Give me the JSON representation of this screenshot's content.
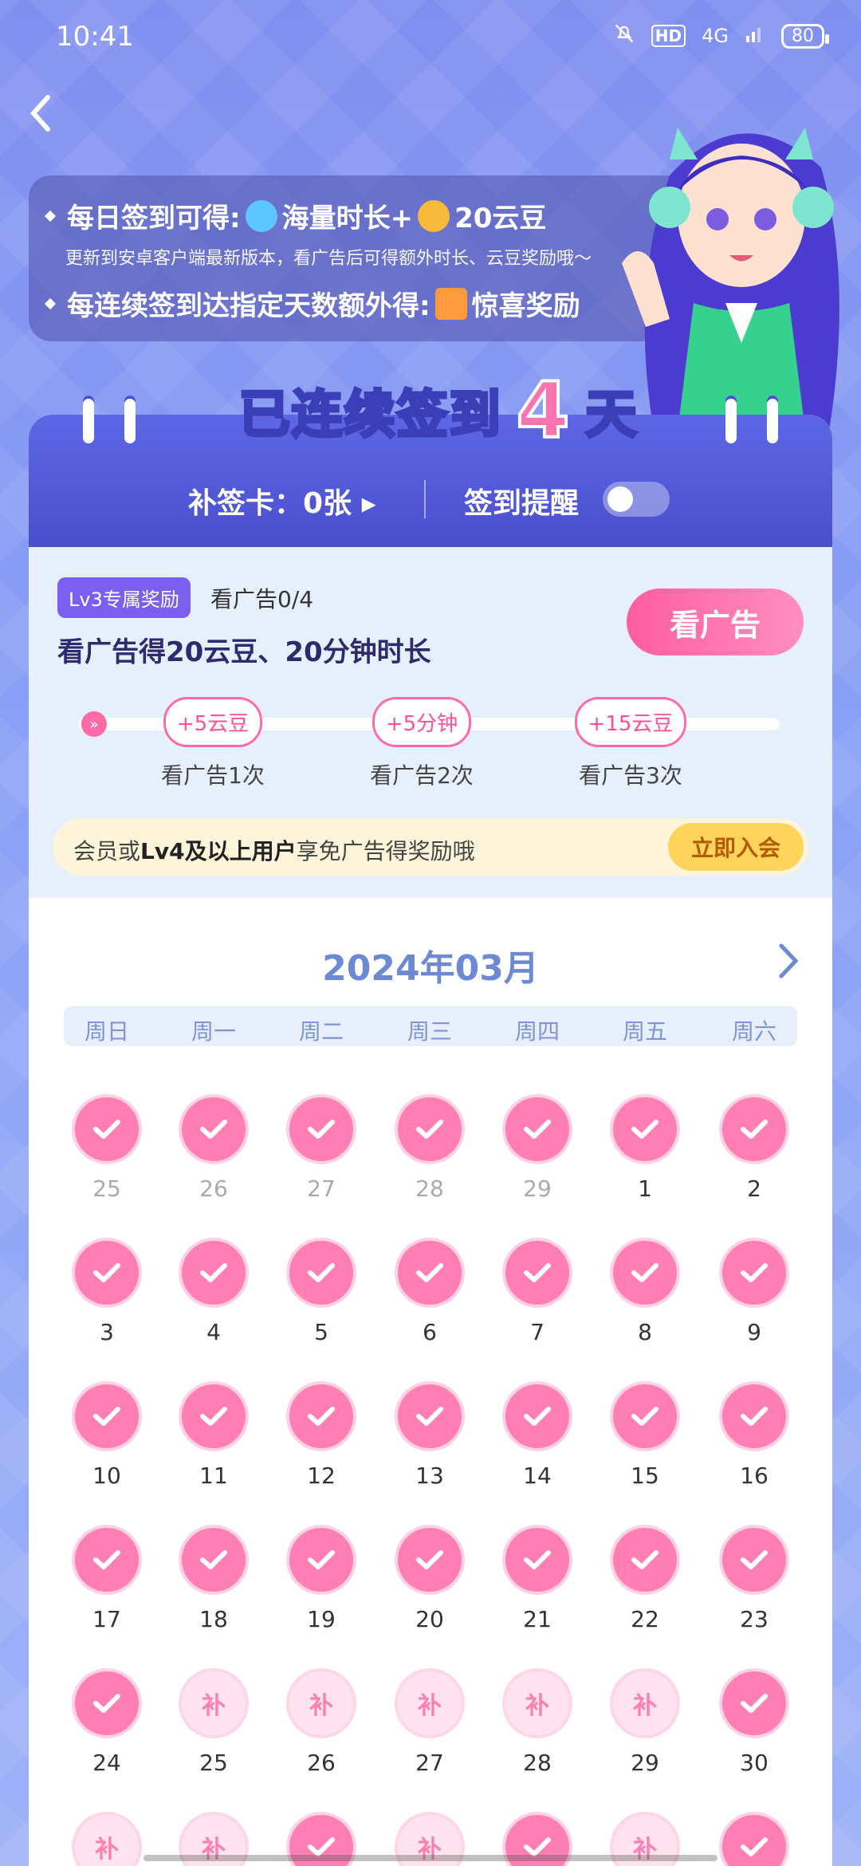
{
  "status": {
    "time": "10:41",
    "network": "4G",
    "battery": "80",
    "hd": "HD"
  },
  "promo": {
    "line1_prefix": "每日签到可得:",
    "line1_item1": "海量时长+",
    "line1_item2": "20云豆",
    "line2": "更新到安卓客户端最新版本，看广告后可得额外时长、云豆奖励哦～",
    "line3_prefix": "每连续签到达指定天数额外得:",
    "line3_item": "惊喜奖励"
  },
  "streak": {
    "prefix": "已连续签到",
    "days": "4",
    "suffix": "天"
  },
  "header": {
    "makeup_card": "补签卡：0张 ▸",
    "remind_label": "签到提醒",
    "remind_on": false
  },
  "ad": {
    "badge": "Lv3专属奖励",
    "count": "看广告0/4",
    "reward": "看广告得20云豆、20分钟时长",
    "button": "看广告",
    "milestones": [
      {
        "reward": "+5云豆",
        "label": "看广告1次"
      },
      {
        "reward": "+5分钟",
        "label": "看广告2次"
      },
      {
        "reward": "+15云豆",
        "label": "看广告3次"
      }
    ],
    "vip_text_1": "会员或",
    "vip_text_bold": "Lv4及以上用户",
    "vip_text_2": "享免广告得奖励哦",
    "vip_button": "立即入会"
  },
  "calendar": {
    "month": "2024年03月",
    "weekdays": [
      "周日",
      "周一",
      "周二",
      "周三",
      "周四",
      "周五",
      "周六"
    ],
    "makeup_mark": "补",
    "days": [
      {
        "n": "25",
        "s": "checked",
        "prev": true
      },
      {
        "n": "26",
        "s": "checked",
        "prev": true
      },
      {
        "n": "27",
        "s": "checked",
        "prev": true
      },
      {
        "n": "28",
        "s": "checked",
        "prev": true
      },
      {
        "n": "29",
        "s": "checked",
        "prev": true
      },
      {
        "n": "1",
        "s": "checked"
      },
      {
        "n": "2",
        "s": "checked"
      },
      {
        "n": "3",
        "s": "checked"
      },
      {
        "n": "4",
        "s": "checked"
      },
      {
        "n": "5",
        "s": "checked"
      },
      {
        "n": "6",
        "s": "checked"
      },
      {
        "n": "7",
        "s": "checked"
      },
      {
        "n": "8",
        "s": "checked"
      },
      {
        "n": "9",
        "s": "checked"
      },
      {
        "n": "10",
        "s": "checked"
      },
      {
        "n": "11",
        "s": "checked"
      },
      {
        "n": "12",
        "s": "checked"
      },
      {
        "n": "13",
        "s": "checked"
      },
      {
        "n": "14",
        "s": "checked"
      },
      {
        "n": "15",
        "s": "checked"
      },
      {
        "n": "16",
        "s": "checked"
      },
      {
        "n": "17",
        "s": "checked"
      },
      {
        "n": "18",
        "s": "checked"
      },
      {
        "n": "19",
        "s": "checked"
      },
      {
        "n": "20",
        "s": "checked"
      },
      {
        "n": "21",
        "s": "checked"
      },
      {
        "n": "22",
        "s": "checked"
      },
      {
        "n": "23",
        "s": "checked"
      },
      {
        "n": "24",
        "s": "checked"
      },
      {
        "n": "25",
        "s": "makeup"
      },
      {
        "n": "26",
        "s": "makeup"
      },
      {
        "n": "27",
        "s": "makeup"
      },
      {
        "n": "28",
        "s": "makeup"
      },
      {
        "n": "29",
        "s": "makeup"
      },
      {
        "n": "30",
        "s": "checked"
      },
      {
        "n": "",
        "s": "makeup"
      },
      {
        "n": "",
        "s": "makeup"
      },
      {
        "n": "",
        "s": "checked"
      },
      {
        "n": "",
        "s": "makeup"
      },
      {
        "n": "",
        "s": "checked"
      },
      {
        "n": "",
        "s": "makeup"
      },
      {
        "n": "",
        "s": "checked"
      }
    ]
  },
  "colors": {
    "accent_pink": "#ff7eb4",
    "header_blue": "#4a4fcc",
    "vip_yellow": "#ffd45a"
  }
}
